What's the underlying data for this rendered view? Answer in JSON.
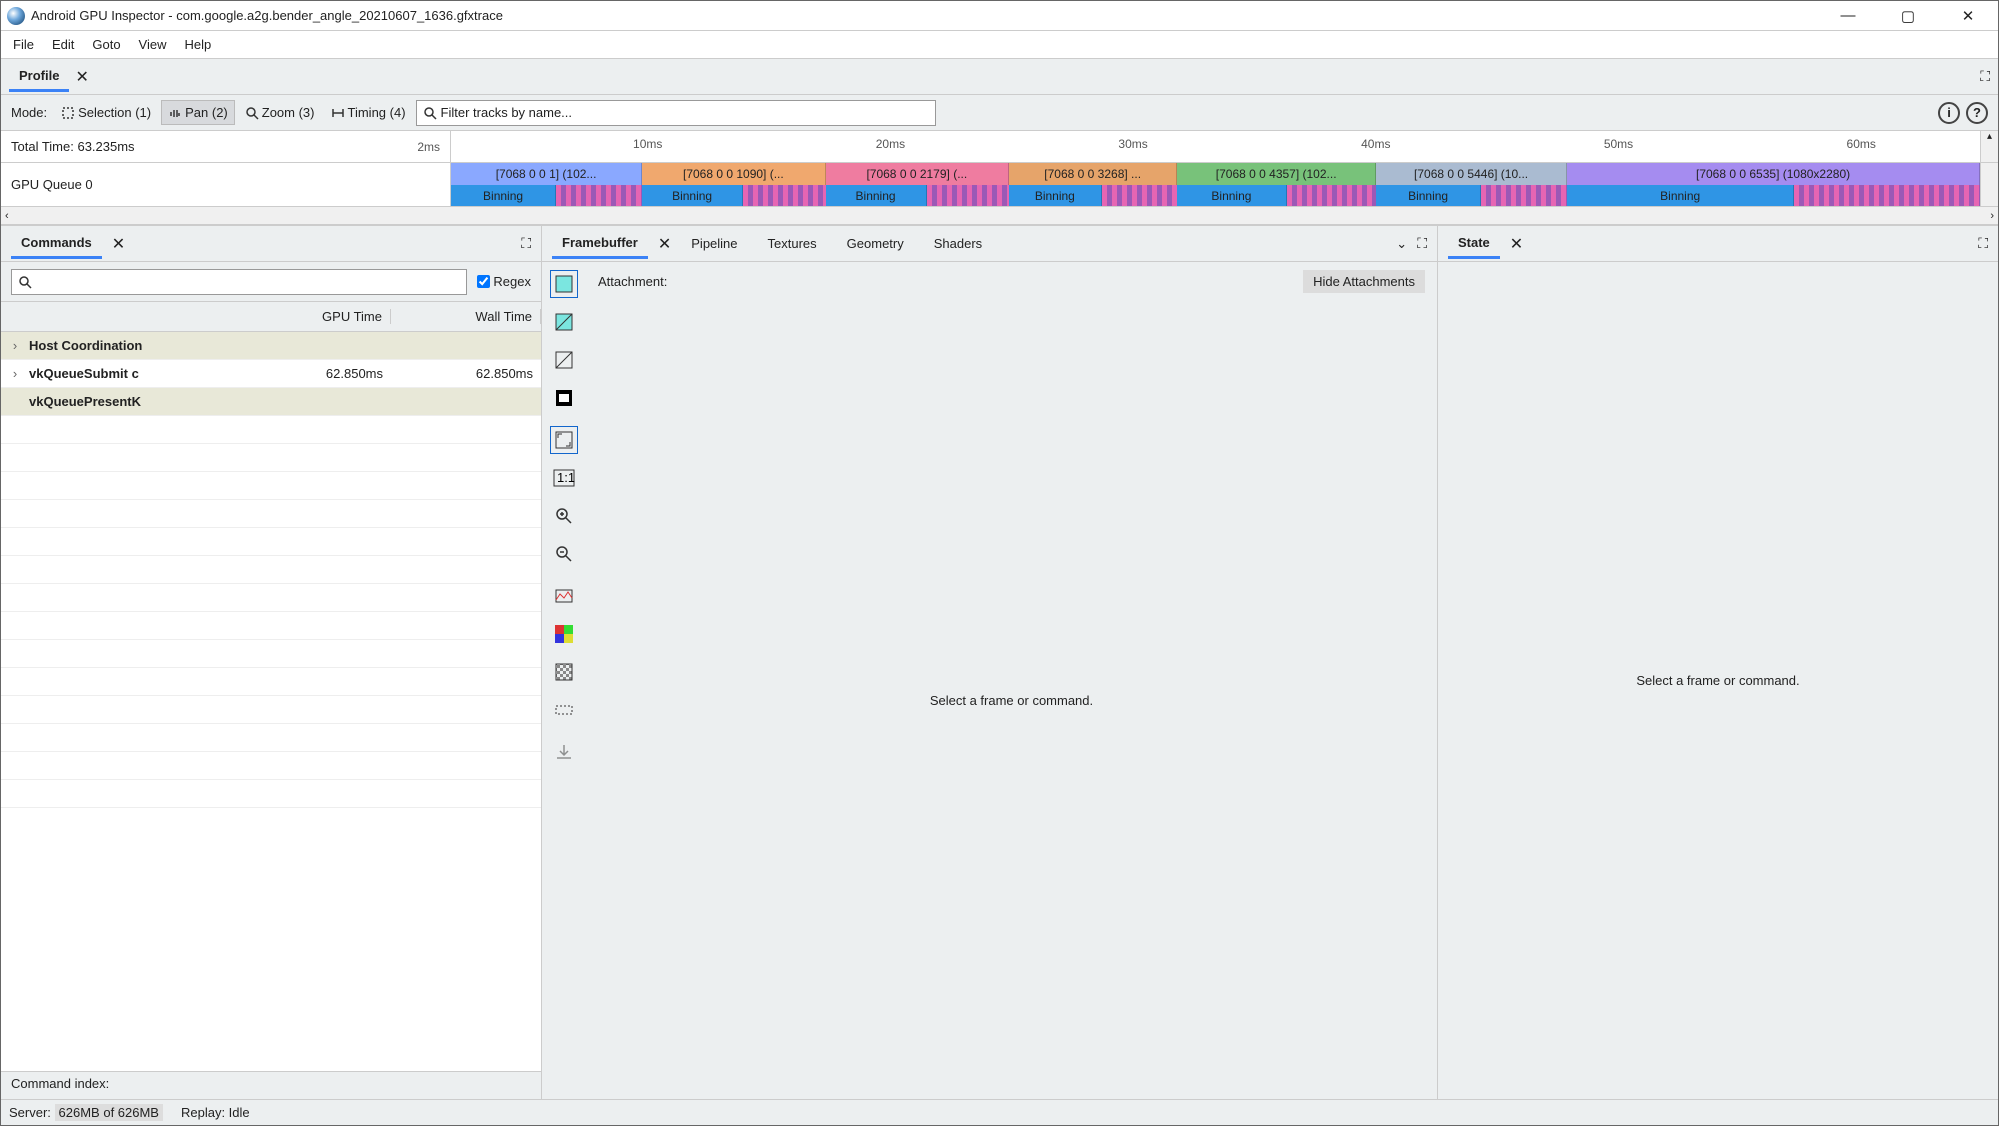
{
  "window": {
    "title": "Android GPU Inspector - com.google.a2g.bender_angle_20210607_1636.gfxtrace"
  },
  "menu": [
    "File",
    "Edit",
    "Goto",
    "View",
    "Help"
  ],
  "top_tab": {
    "label": "Profile"
  },
  "profile": {
    "mode_label": "Mode:",
    "modes": {
      "selection": "Selection (1)",
      "pan": "Pan (2)",
      "zoom": "Zoom (3)",
      "timing": "Timing (4)"
    },
    "filter_placeholder": "Filter tracks by name...",
    "total_time_label": "Total Time: 63.235ms",
    "ruler_start": "2ms",
    "ruler_ticks": [
      "10ms",
      "20ms",
      "30ms",
      "40ms",
      "50ms",
      "60ms"
    ],
    "queue_label": "GPU Queue 0",
    "cmd_blocks": [
      {
        "label": "[7068 0 0 1] (102...",
        "color": "#8aa8ff"
      },
      {
        "label": "[7068 0 0 1090] (...",
        "color": "#f0a86e"
      },
      {
        "label": "[7068 0 0 2179] (...",
        "color": "#ef7ca0"
      },
      {
        "label": "[7068 0 0 3268] ...",
        "color": "#e6a46a"
      },
      {
        "label": "[7068 0 0 4357] (102...",
        "color": "#78c27a"
      },
      {
        "label": "[7068 0 0 5446] (10...",
        "color": "#aabbd1"
      },
      {
        "label": "[7068 0 0 6535] (1080x2280)",
        "color": "#a58cf0"
      }
    ],
    "bin_label": "Binning"
  },
  "commands": {
    "tab_label": "Commands",
    "regex_label": "Regex",
    "cols": {
      "c2": "GPU Time",
      "c3": "Wall Time"
    },
    "rows": [
      {
        "expand": "›",
        "name": "Host Coordination",
        "gpu": "",
        "wall": "",
        "sel": true,
        "bold": true
      },
      {
        "expand": "›",
        "name": "vkQueueSubmit c",
        "gpu": "62.850ms",
        "wall": "62.850ms",
        "sel": false,
        "bold": true
      },
      {
        "expand": "",
        "name": "vkQueuePresentK",
        "gpu": "",
        "wall": "",
        "sel": true,
        "bold": true
      }
    ],
    "footer": "Command index:"
  },
  "framebuffer": {
    "tabs": [
      "Framebuffer",
      "Pipeline",
      "Textures",
      "Geometry",
      "Shaders"
    ],
    "attachment_label": "Attachment:",
    "hide_btn": "Hide Attachments",
    "placeholder": "Select a frame or command."
  },
  "state": {
    "tab_label": "State",
    "placeholder": "Select a frame or command."
  },
  "status": {
    "server_label": "Server:",
    "server_value": "626MB of 626MB",
    "replay": "Replay: Idle"
  }
}
